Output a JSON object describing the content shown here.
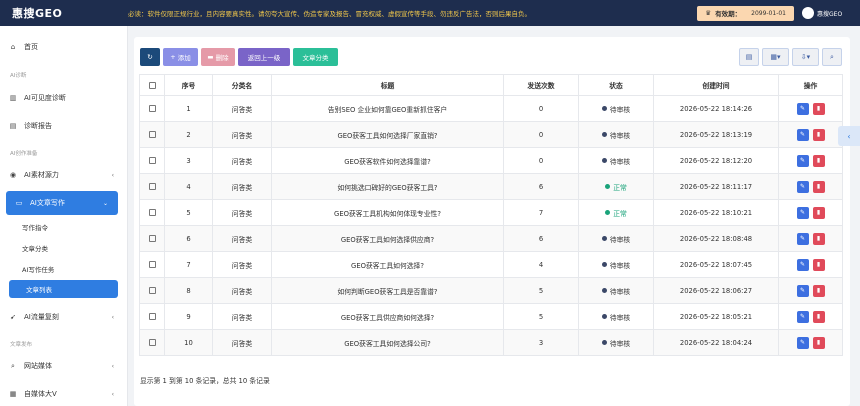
{
  "topbar": {
    "logo": "惠搜GEO",
    "notice": "必读：软件仅限正规行业，且内容要真实性。请勿夸大宣传、伪造专家及报告、冒充权威、虚假宣传等手段、勿违反广告法，否则后果自负。",
    "expiry_label": "有效期：",
    "expiry_date": "2099-01-01",
    "user_name": "惠搜GEO"
  },
  "sidebar": {
    "home": "首页",
    "sec_diagnosis": "AI诊断",
    "visibility": "AI可见度诊断",
    "report": "诊断报告",
    "sec_creation": "AI创作准备",
    "material": "AI素材源力",
    "writing": "AI文章写作",
    "sub_items": [
      "写作指令",
      "文章分类",
      "AI写作任务"
    ],
    "sub_active": "文章列表",
    "traffic": "AI流量复刻",
    "sec_publish": "文章发布",
    "website_media": "网站媒体",
    "self_media": "自媒体大V"
  },
  "toolbar": {
    "add": "添加",
    "delete": "删除",
    "back": "返回上一级",
    "category": "文章分类"
  },
  "table": {
    "headers": [
      "序号",
      "分类名",
      "标题",
      "发送次数",
      "状态",
      "创建时间",
      "操作"
    ],
    "rows": [
      {
        "no": "1",
        "cat": "问答类",
        "title": "告别SEO 企业如何靠GEO重新抓住客户",
        "sends": "0",
        "status": "待审核",
        "time": "2026-05-22 18:14:26"
      },
      {
        "no": "2",
        "cat": "问答类",
        "title": "GEO获客工具如何选择厂家直销?",
        "sends": "0",
        "status": "待审核",
        "time": "2026-05-22 18:13:19"
      },
      {
        "no": "3",
        "cat": "问答类",
        "title": "GEO获客软件如何选择靠谱?",
        "sends": "0",
        "status": "待审核",
        "time": "2026-05-22 18:12:20"
      },
      {
        "no": "4",
        "cat": "问答类",
        "title": "如何挑选口碑好的GEO获客工具?",
        "sends": "6",
        "status": "正常",
        "time": "2026-05-22 18:11:17"
      },
      {
        "no": "5",
        "cat": "问答类",
        "title": "GEO获客工具机构如何体现专业性?",
        "sends": "7",
        "status": "正常",
        "time": "2026-05-22 18:10:21"
      },
      {
        "no": "6",
        "cat": "问答类",
        "title": "GEO获客工具如何选择供应商?",
        "sends": "6",
        "status": "待审核",
        "time": "2026-05-22 18:08:48"
      },
      {
        "no": "7",
        "cat": "问答类",
        "title": "GEO获客工具如何选择?",
        "sends": "4",
        "status": "待审核",
        "time": "2026-05-22 18:07:45"
      },
      {
        "no": "8",
        "cat": "问答类",
        "title": "如何判断GEO获客工具是否靠谱?",
        "sends": "5",
        "status": "待审核",
        "time": "2026-05-22 18:06:27"
      },
      {
        "no": "9",
        "cat": "问答类",
        "title": "GEO获客工具供应商如何选择?",
        "sends": "5",
        "status": "待审核",
        "time": "2026-05-22 18:05:21"
      },
      {
        "no": "10",
        "cat": "问答类",
        "title": "GEO获客工具如何选择公司?",
        "sends": "3",
        "status": "待审核",
        "time": "2026-05-22 18:04:24"
      }
    ]
  },
  "footer": "显示第 1 到第 10 条记录，总共 10 条记录",
  "colors": {
    "topbar": "#1e2d4e",
    "accent": "#2f7de1",
    "refresh": "#1c4a7a",
    "add": "#8a8fe6",
    "delete": "#e59aa8",
    "back": "#7a64c8",
    "category": "#2bbf98",
    "edit": "#3d6fe0",
    "remove": "#e04a5a",
    "pending_dot": "#3b4868",
    "ok_dot": "#1aa37a"
  }
}
